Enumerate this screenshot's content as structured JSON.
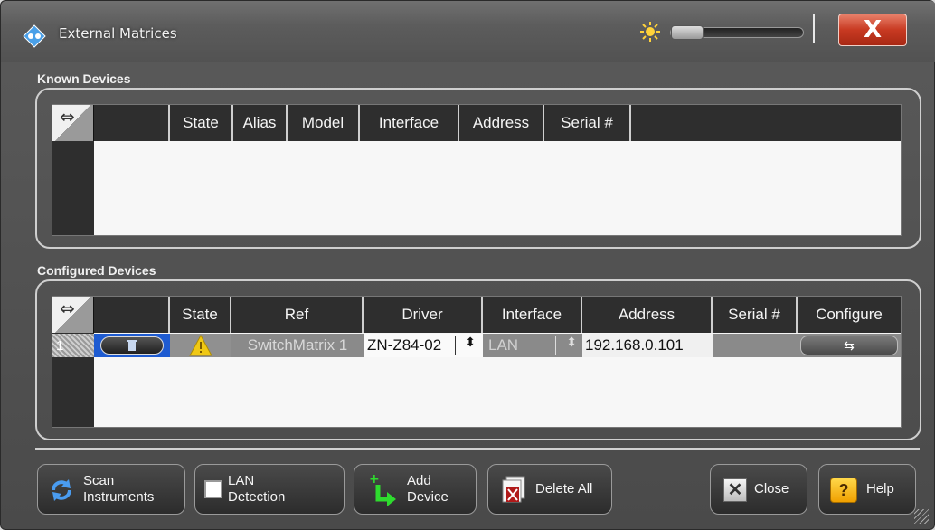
{
  "window": {
    "title": "External Matrices",
    "close_glyph": "X"
  },
  "known_devices": {
    "label": "Known Devices",
    "columns": [
      "State",
      "Alias",
      "Model",
      "Interface",
      "Address",
      "Serial #"
    ],
    "rows": []
  },
  "configured_devices": {
    "label": "Configured Devices",
    "columns": [
      "State",
      "Ref",
      "Driver",
      "Interface",
      "Address",
      "Serial #",
      "Configure"
    ],
    "rows": [
      {
        "row_number": "1",
        "ref": "SwitchMatrix 1",
        "driver": "ZN-Z84-02",
        "interface": "LAN",
        "address": "192.168.0.101",
        "serial": ""
      }
    ]
  },
  "buttons": {
    "scan": {
      "line1": "Scan",
      "line2": "Instruments"
    },
    "lan": {
      "line1": "LAN",
      "line2": "Detection",
      "checked": false
    },
    "add": {
      "line1": "Add",
      "line2": "Device"
    },
    "delete_all": "Delete All",
    "close": "Close",
    "help": "Help"
  },
  "icons": {
    "app": "rs-logo-icon",
    "brightness": "sun-icon",
    "warning": "warning-icon",
    "delete": "trash-icon",
    "scan": "refresh-icon",
    "add": "add-device-icon",
    "delete_all": "delete-all-icon",
    "close": "close-icon",
    "help": "help-icon"
  },
  "colors": {
    "accent_blue": "#2a6fe0",
    "warning_yellow": "#f0c814",
    "title_close_red": "#c83a22"
  }
}
